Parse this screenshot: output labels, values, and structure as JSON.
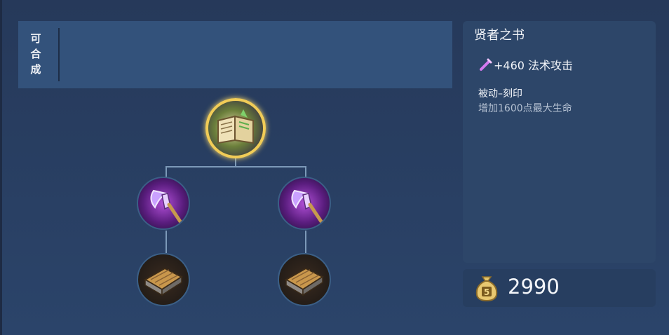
{
  "craftable": {
    "label_chars": [
      "可",
      "合",
      "成"
    ]
  },
  "item": {
    "name": "贤者之书",
    "attribute": "+460 法术攻击",
    "passive_name": "被动–刻印",
    "passive_desc": "增加1600点最大生命",
    "price": "2990"
  },
  "tree": {
    "root": {
      "icon": "sage-book-icon"
    },
    "mid": [
      {
        "icon": "magic-staff-icon"
      },
      {
        "icon": "magic-staff-icon"
      }
    ],
    "bottom": [
      {
        "icon": "tome-icon"
      },
      {
        "icon": "tome-icon"
      }
    ]
  },
  "colors": {
    "highlight_border": "#f1cc57",
    "attr_icon": "#d479f0",
    "panel": "#2d4669"
  }
}
